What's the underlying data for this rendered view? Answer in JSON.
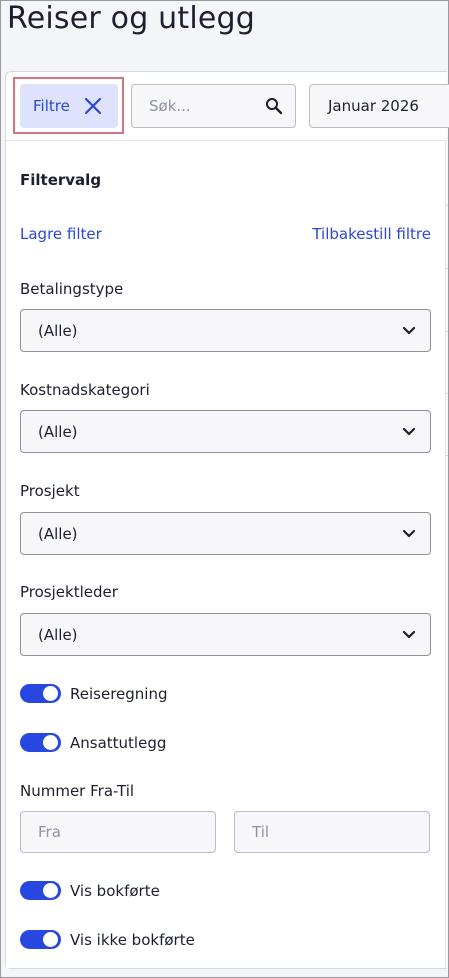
{
  "header": {
    "title": "Reiser og utlegg"
  },
  "toolbar": {
    "filter_button": "Filtre",
    "search_placeholder": "Søk...",
    "period": "Januar 2026"
  },
  "filters": {
    "heading": "Filtervalg",
    "save_filter": "Lagre filter",
    "reset_filters": "Tilbakestill filtre",
    "selects": [
      {
        "label": "Betalingstype",
        "value": "(Alle)"
      },
      {
        "label": "Kostnadskategori",
        "value": "(Alle)"
      },
      {
        "label": "Prosjekt",
        "value": "(Alle)"
      },
      {
        "label": "Prosjektleder",
        "value": "(Alle)"
      }
    ],
    "toggles_top": [
      {
        "label": "Reiseregning",
        "on": true
      },
      {
        "label": "Ansattutlegg",
        "on": true
      }
    ],
    "number_range": {
      "label": "Nummer Fra-Til",
      "from_placeholder": "Fra",
      "to_placeholder": "Til"
    },
    "toggles_bottom": [
      {
        "label": "Vis bokførte",
        "on": true
      },
      {
        "label": "Vis ikke bokførte",
        "on": true
      }
    ]
  },
  "colors": {
    "accent": "#2747e1",
    "link": "#2b47d6",
    "chip_bg": "#dfe2fb",
    "highlight_outline": "#d2737e"
  }
}
